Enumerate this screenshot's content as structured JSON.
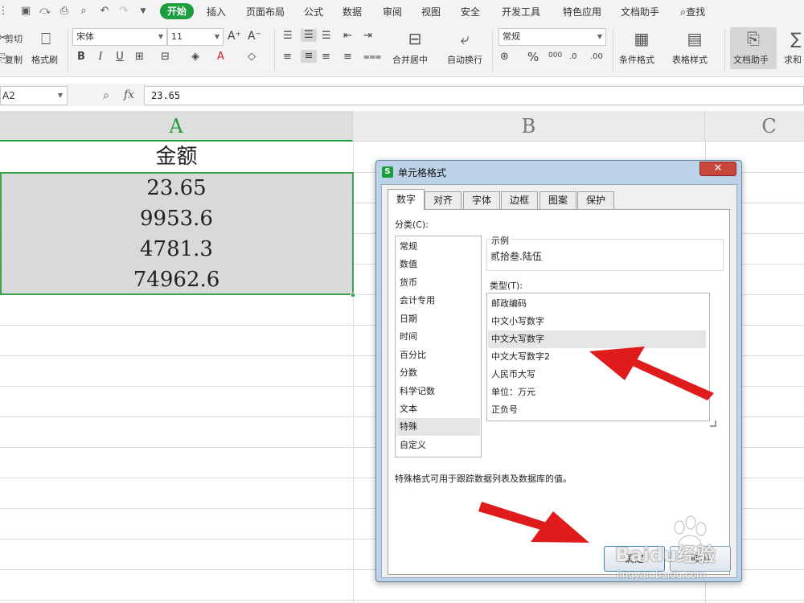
{
  "quick_access": {
    "icons": [
      "menu-icon",
      "save-icon",
      "format-painter-icon",
      "print-icon",
      "print-preview-icon",
      "undo-icon",
      "redo-icon",
      "dropdown-icon"
    ]
  },
  "menu": {
    "active_tab": "开始",
    "tabs": [
      "插入",
      "页面布局",
      "公式",
      "数据",
      "审阅",
      "视图",
      "安全",
      "开发工具",
      "特色应用",
      "文档助手"
    ],
    "search_label": "查找"
  },
  "ribbon": {
    "cut_label": "剪切",
    "copy_label": "复制",
    "format_painter_label": "格式刷",
    "font_name": "宋体",
    "font_size": "11",
    "bold": "B",
    "italic": "I",
    "underline": "U",
    "font_grow": "A⁺",
    "font_shrink": "A⁻",
    "merge_label": "合并居中",
    "wrap_label": "自动换行",
    "number_format": "常规",
    "percent": "%",
    "thousands": "000",
    "conditional_label": "条件格式",
    "table_style_label": "表格样式",
    "doc_assist_label": "文档助手",
    "sum_label": "求和"
  },
  "formula_bar": {
    "name_box": "A2",
    "fx": "fx",
    "value": "23.65"
  },
  "sheet": {
    "columns": [
      "A",
      "B",
      "C"
    ],
    "header_cell": "金额",
    "values": [
      "23.65",
      "9953.6",
      "4781.3",
      "74962.6"
    ]
  },
  "dialog": {
    "title": "单元格格式",
    "close": "✕",
    "tabs": [
      "数字",
      "对齐",
      "字体",
      "边框",
      "图案",
      "保护"
    ],
    "category_label": "分类(C):",
    "categories": [
      "常规",
      "数值",
      "货币",
      "会计专用",
      "日期",
      "时间",
      "百分比",
      "分数",
      "科学记数",
      "文本",
      "特殊",
      "自定义"
    ],
    "selected_category": "特殊",
    "sample_label": "示例",
    "sample_value": "贰拾叁.陆伍",
    "type_label": "类型(T):",
    "types": [
      "邮政编码",
      "中文小写数字",
      "中文大写数字",
      "中文大写数字2",
      "人民币大写",
      "单位：万元",
      "正负号"
    ],
    "selected_type": "中文大写数字",
    "description": "特殊格式可用于跟踪数据列表及数据库的值。",
    "ok_label": "确定",
    "cancel_label": "取消"
  },
  "watermark": {
    "brand": "Baidu经验",
    "url": "jingyan.baidu.com"
  },
  "colors": {
    "accent_green": "#1b9e3b",
    "arrow_red": "#e01b1b",
    "selection_fill": "#d9d9d9"
  }
}
